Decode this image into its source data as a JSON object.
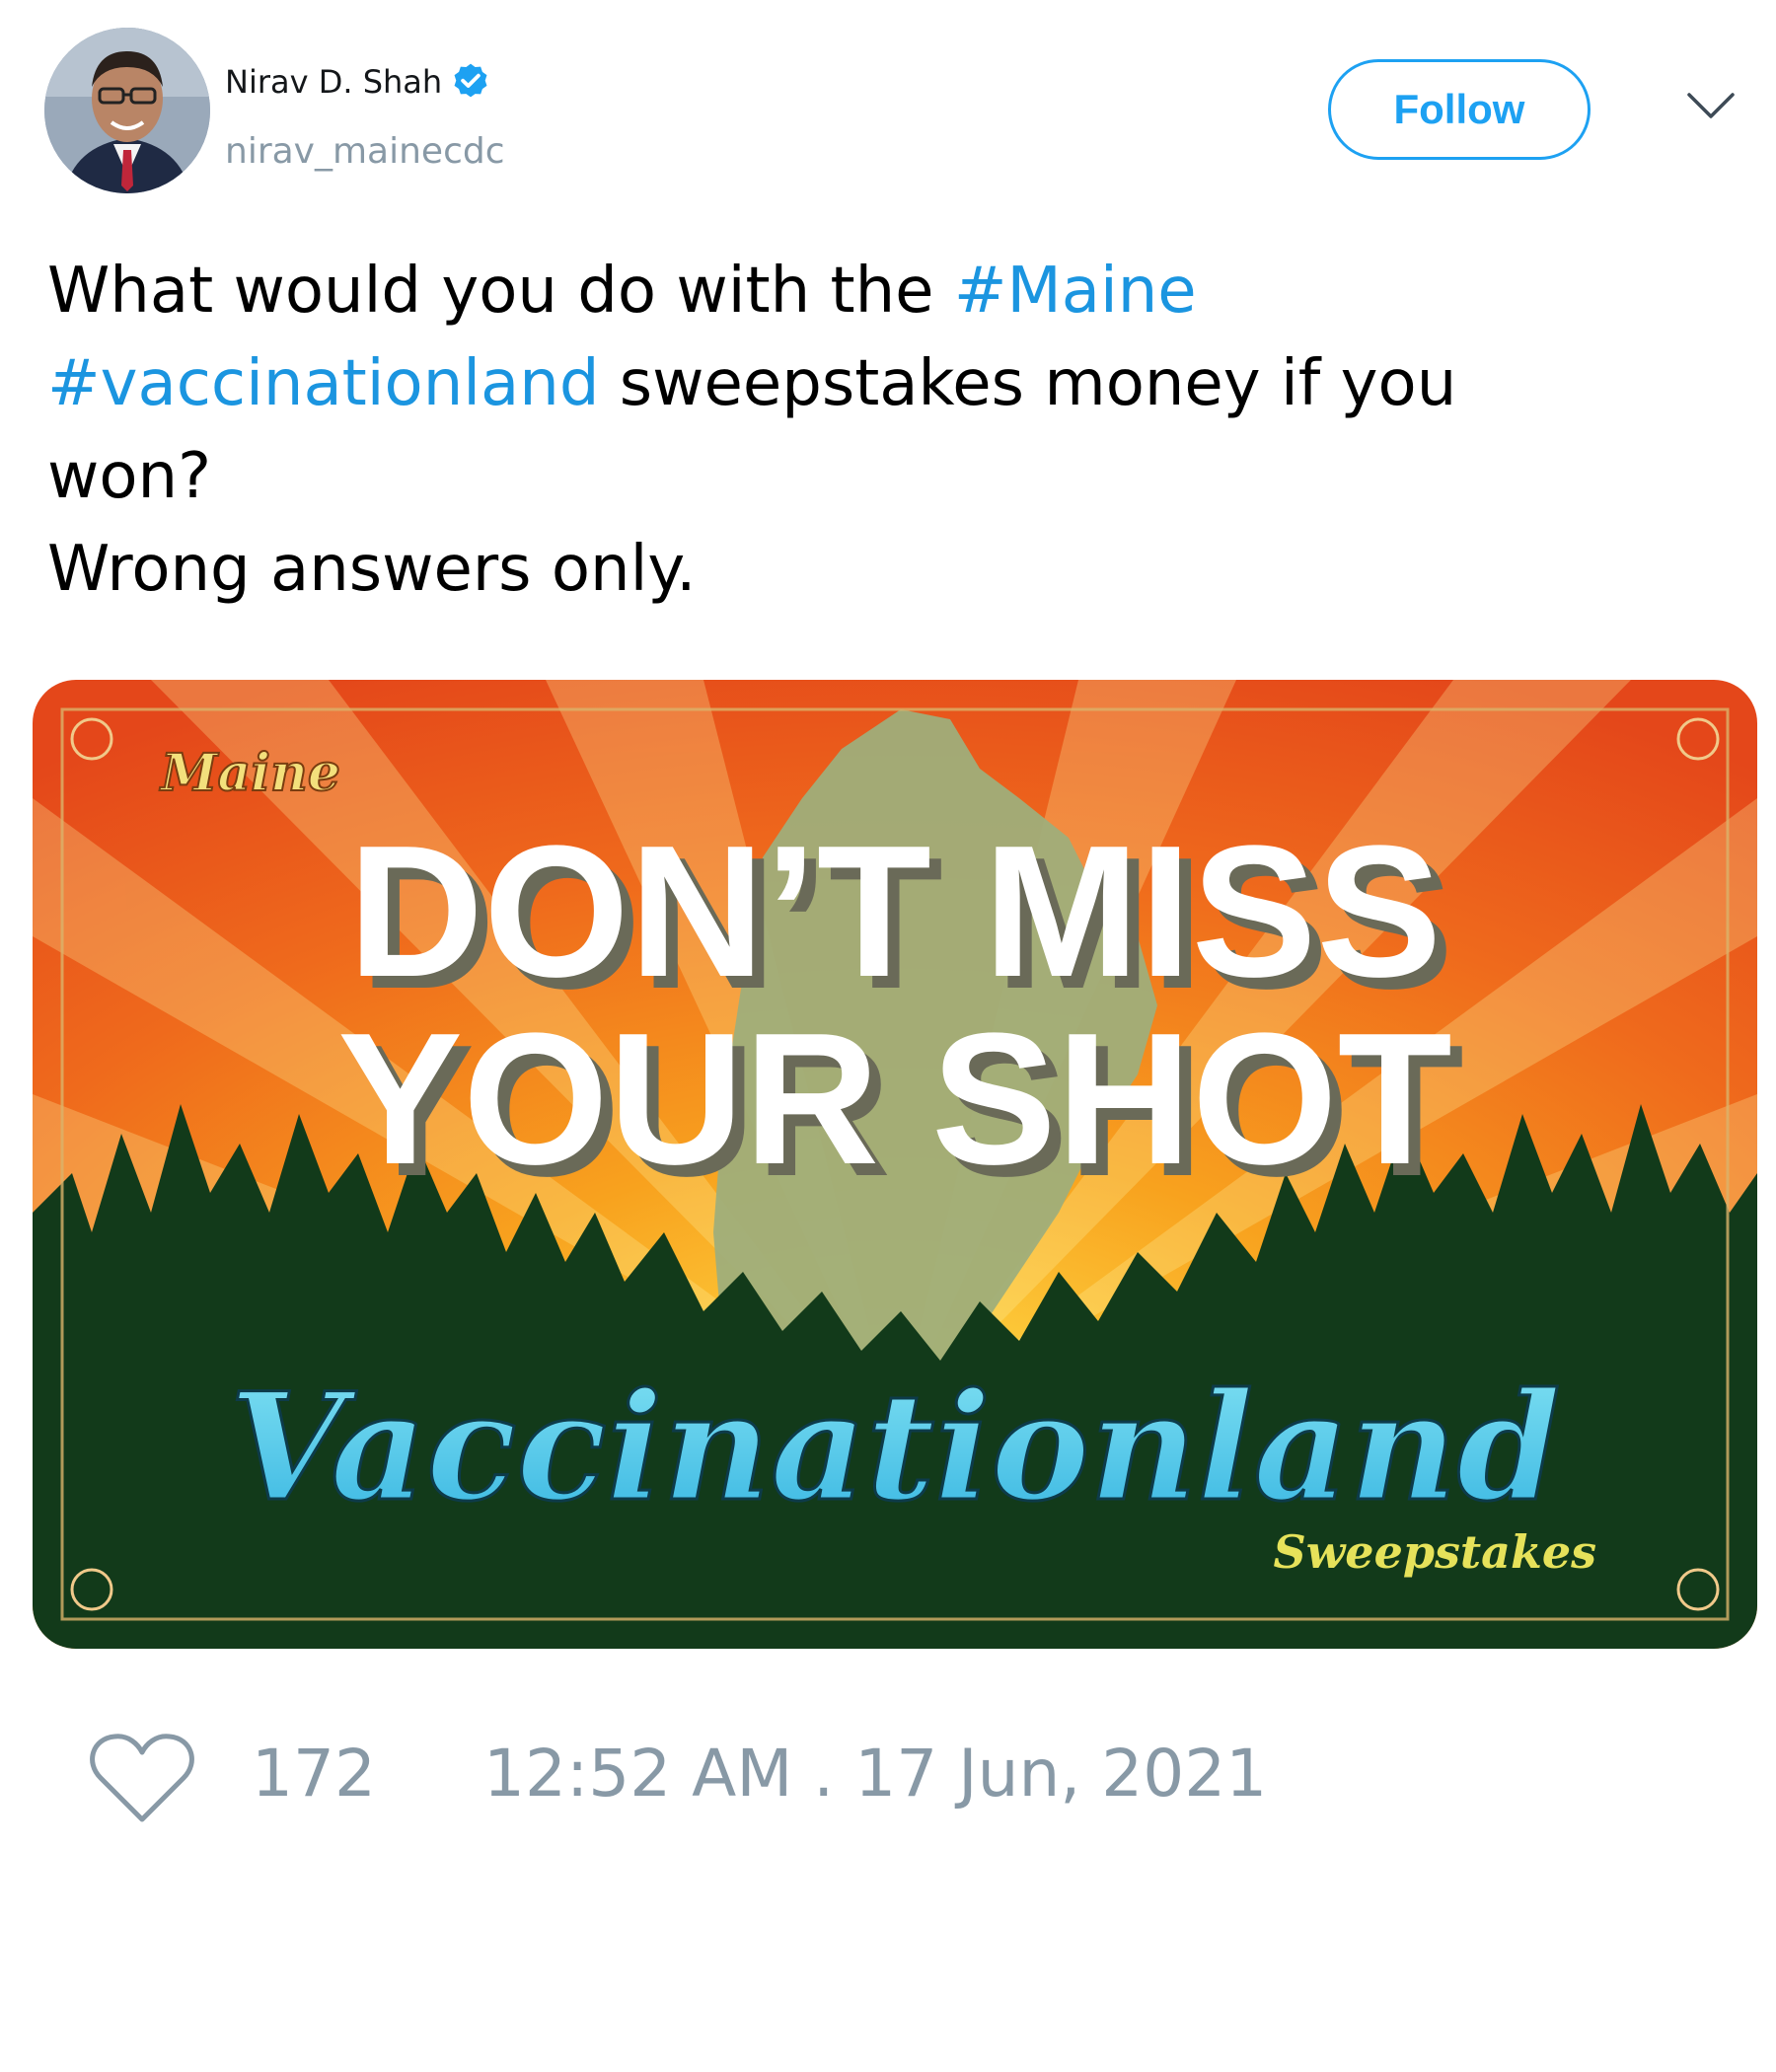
{
  "user": {
    "display_name": "Nirav D. Shah",
    "handle": "nirav_mainecdc",
    "verified": true
  },
  "header": {
    "follow_label": "Follow",
    "menu_icon": "chevron-down-icon"
  },
  "tweet": {
    "line1_prefix": "What would you do with the ",
    "hashtag1": "#Maine",
    "hashtag2": "#vaccinationland",
    "line2_suffix": " sweepstakes money if you",
    "line3": "won?",
    "line4": "Wrong answers only."
  },
  "media": {
    "top_script": "Maine",
    "headline_line1": "DON’T MISS",
    "headline_line2": "YOUR SHOT",
    "brand": "Vaccinationland",
    "sub_script": "Sweepstakes"
  },
  "footer": {
    "like_icon": "heart-icon",
    "like_count": "172",
    "timestamp": "12:52 AM . 17 Jun, 2021"
  },
  "colors": {
    "accent": "#1da1f2",
    "hashtag": "#1b95e0",
    "muted": "#8899a6",
    "poster_orange": "#e8531b",
    "poster_green": "#123a1a",
    "poster_cyan": "#4fc6e6"
  }
}
